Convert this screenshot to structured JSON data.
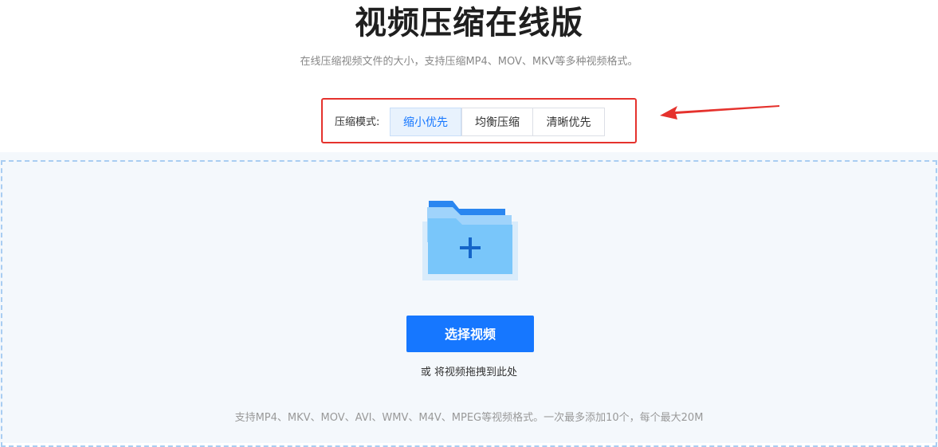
{
  "header": {
    "title": "视频压缩在线版",
    "subtitle": "在线压缩视频文件的大小，支持压缩MP4、MOV、MKV等多种视频格式。"
  },
  "mode": {
    "label": "压缩模式:",
    "options": [
      "缩小优先",
      "均衡压缩",
      "清晰优先"
    ],
    "selected": "缩小优先"
  },
  "upload": {
    "button_label": "选择视频",
    "drag_hint": "或 将视频拖拽到此处",
    "support_text": "支持MP4、MKV、MOV、AVI、WMV、M4V、MPEG等视频格式。一次最多添加10个，每个最大20M"
  },
  "colors": {
    "accent": "#1677ff",
    "annotation": "#e5322d",
    "drop_bg": "#f4f8fc"
  },
  "icons": {
    "folder": "folder-plus-icon",
    "annotation_arrow": "arrow-left-icon"
  }
}
